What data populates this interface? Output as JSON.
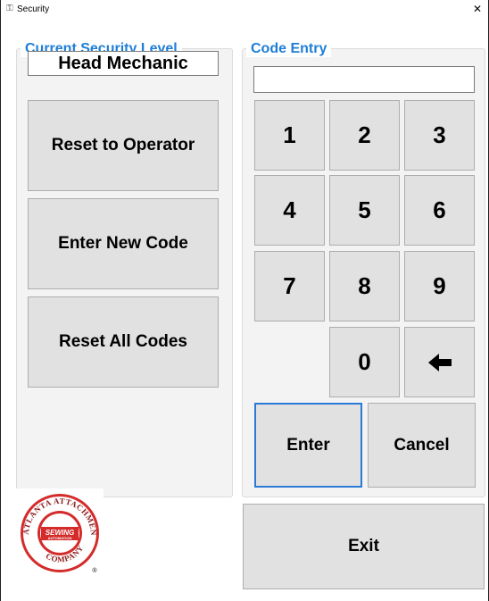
{
  "window": {
    "title": "Security",
    "app_icon": "keys-icon",
    "close_glyph": "✕"
  },
  "current_level": {
    "heading": "Current Security Level",
    "value": "Head Mechanic"
  },
  "actions": {
    "reset_to_operator": "Reset to Operator",
    "enter_new_code": "Enter New Code",
    "reset_all_codes": "Reset All Codes"
  },
  "code_entry": {
    "heading": "Code Entry",
    "value": "",
    "keys": [
      "1",
      "2",
      "3",
      "4",
      "5",
      "6",
      "7",
      "8",
      "9",
      "0"
    ],
    "backspace_icon": "left-arrow-icon",
    "enter": "Enter",
    "cancel": "Cancel"
  },
  "exit": "Exit",
  "logo": {
    "top_text": "ATLANTA ATTACHMENT",
    "bottom_text": "COMPANY",
    "center_line1": "SEWING",
    "center_line2": "AUTOMATION",
    "registered": "®",
    "colors": {
      "red": "#d42b2b",
      "ring": "#ffffff",
      "text": "#8a1a1a"
    }
  },
  "colors": {
    "accent": "#1e7ed6",
    "button_face": "#e1e1e1",
    "group_bg": "#f3f3f3"
  }
}
